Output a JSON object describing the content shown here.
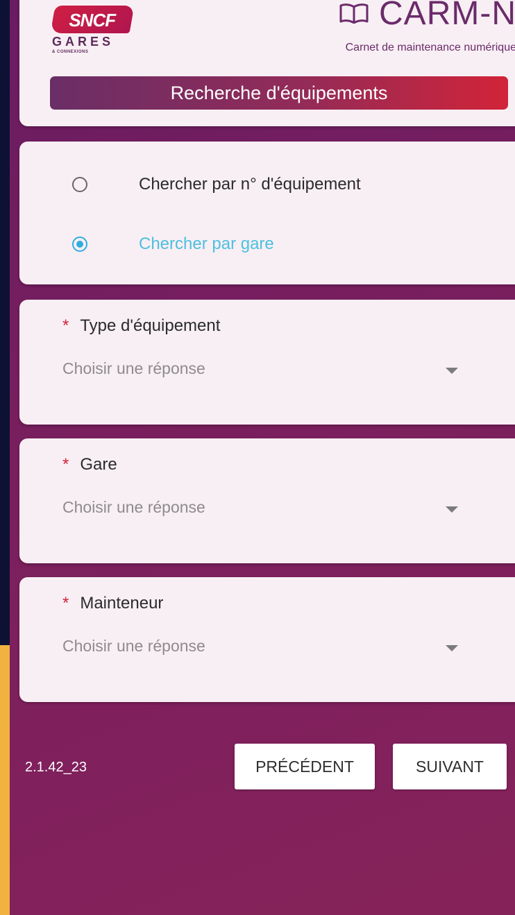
{
  "header": {
    "sncf_logo_text": "SNCF",
    "gares_text": "GARES",
    "connexions_text": "& CONNEXIONS",
    "app_name": "CARM-N",
    "app_subtitle": "Carnet de maintenance numérique",
    "page_title": "Recherche d'équipements",
    "colors": {
      "brand_red": "#d12438",
      "brand_purple": "#6a2b6a"
    }
  },
  "search_mode": {
    "options": [
      {
        "label": "Chercher par n° d'équipement",
        "selected": false
      },
      {
        "label": "Chercher par gare",
        "selected": true
      }
    ],
    "accent_color": "#2eaee0"
  },
  "fields": [
    {
      "required_mark": "*",
      "label": "Type d'équipement",
      "placeholder": "Choisir une réponse"
    },
    {
      "required_mark": "*",
      "label": "Gare",
      "placeholder": "Choisir une réponse"
    },
    {
      "required_mark": "*",
      "label": "Mainteneur",
      "placeholder": "Choisir une réponse"
    }
  ],
  "footer": {
    "version": "2.1.42_23",
    "prev_label": "PRÉCÉDENT",
    "next_label": "SUIVANT"
  },
  "icons": {
    "book": "open-book-icon",
    "dropdown": "chevron-down-icon"
  }
}
